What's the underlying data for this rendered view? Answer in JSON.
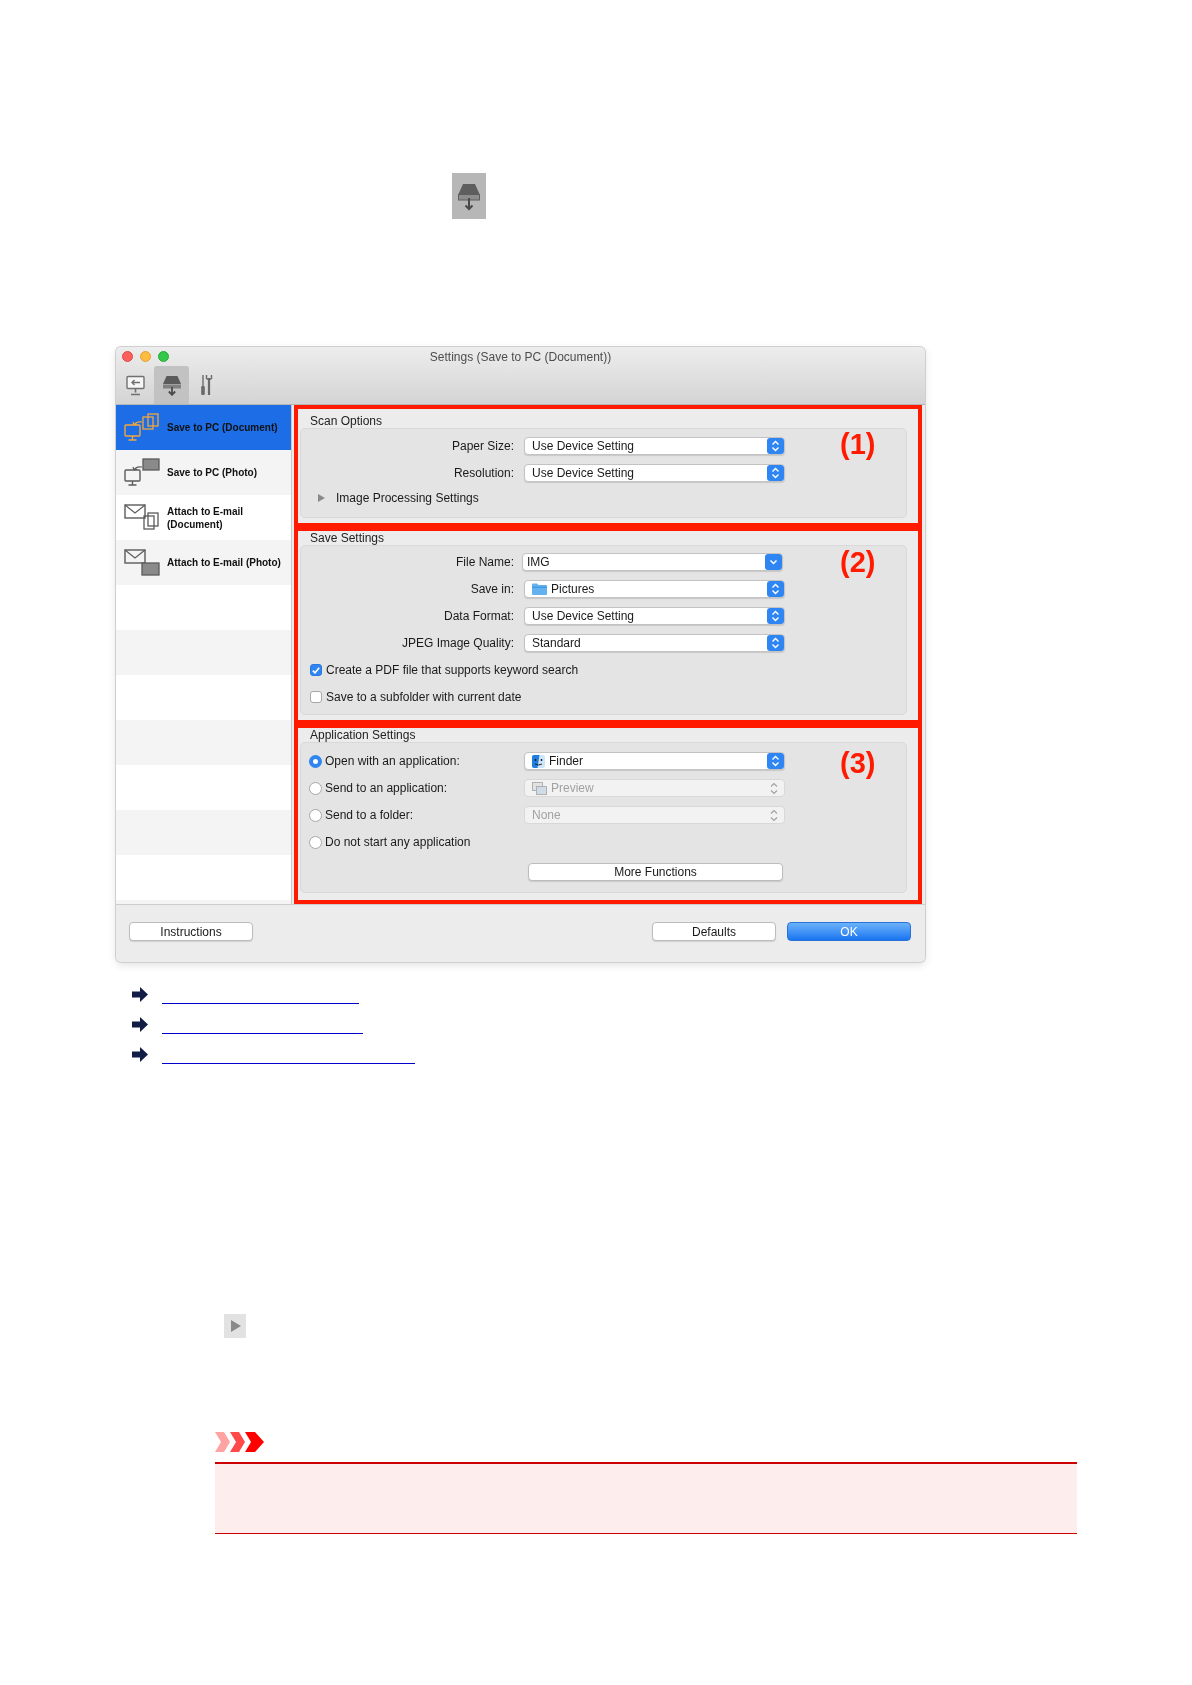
{
  "window": {
    "title": "Settings (Save to PC (Document))"
  },
  "toolbar": {
    "tabs": [
      {
        "kind": "monitor",
        "selected": false
      },
      {
        "kind": "scanner",
        "selected": true
      },
      {
        "kind": "tools",
        "selected": false
      }
    ]
  },
  "sidebar": {
    "items": [
      {
        "label": "Save to PC (Document)",
        "kind": "pc-document",
        "selected": true
      },
      {
        "label": "Save to PC (Photo)",
        "kind": "pc-photo",
        "selected": false
      },
      {
        "label": "Attach to E-mail (Document)",
        "kind": "mail-document",
        "selected": false
      },
      {
        "label": "Attach to E-mail (Photo)",
        "kind": "mail-photo",
        "selected": false
      }
    ]
  },
  "scan_options": {
    "title": "Scan Options",
    "callout": "(1)",
    "fields": [
      {
        "label": "Paper Size:",
        "value": "Use Device Setting",
        "kind": "popup"
      },
      {
        "label": "Resolution:",
        "value": "Use Device Setting",
        "kind": "popup"
      }
    ],
    "disclosure": {
      "label": "Image Processing Settings",
      "expanded": false
    }
  },
  "save_settings": {
    "title": "Save Settings",
    "callout": "(2)",
    "fields": [
      {
        "label": "File Name:",
        "value": "IMG",
        "kind": "combo"
      },
      {
        "label": "Save in:",
        "value": "Pictures",
        "kind": "folder"
      },
      {
        "label": "Data Format:",
        "value": "Use Device Setting",
        "kind": "popup"
      },
      {
        "label": "JPEG Image Quality:",
        "value": "Standard",
        "kind": "popup"
      }
    ],
    "checkboxes": [
      {
        "label": "Create a PDF file that supports keyword search",
        "checked": true
      },
      {
        "label": "Save to a subfolder with current date",
        "checked": false
      }
    ]
  },
  "application_settings": {
    "title": "Application Settings",
    "callout": "(3)",
    "options": [
      {
        "label": "Open with an application:",
        "selected": true,
        "popup": {
          "value": "Finder",
          "kind": "finder",
          "disabled": false
        }
      },
      {
        "label": "Send to an application:",
        "selected": false,
        "popup": {
          "value": "Preview",
          "kind": "preview",
          "disabled": true
        }
      },
      {
        "label": "Send to a folder:",
        "selected": false,
        "popup": {
          "value": "None",
          "kind": "popup",
          "disabled": true
        }
      },
      {
        "label": "Do not start any application",
        "selected": false
      }
    ],
    "button": "More Functions"
  },
  "footer": {
    "left_buttons": [
      {
        "label": "Instructions",
        "primary": false
      }
    ],
    "right_buttons": [
      {
        "label": "Defaults",
        "primary": false
      },
      {
        "label": "OK",
        "primary": true
      }
    ]
  },
  "related_links": [
    {
      "kind": "link"
    },
    {
      "kind": "link"
    },
    {
      "kind": "link"
    }
  ]
}
